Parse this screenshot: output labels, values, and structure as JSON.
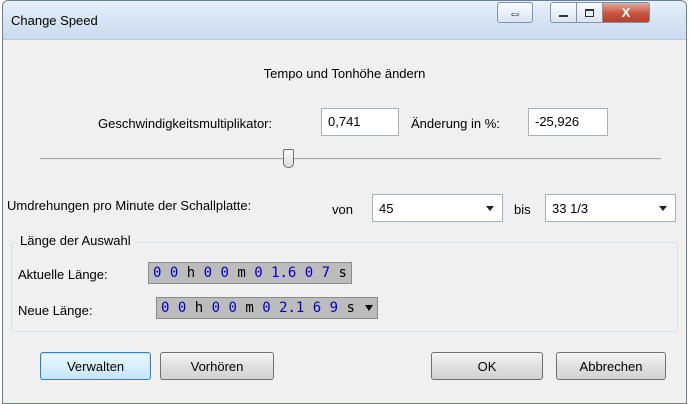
{
  "window": {
    "title": "Change Speed"
  },
  "titlebar": {
    "resize_glyph": "⇔",
    "close_glyph": "X"
  },
  "dialog": {
    "heading": "Tempo und Tonhöhe ändern",
    "multiplier_label": "Geschwindigkeitsmultiplikator:",
    "multiplier_value": "0,741",
    "percent_label": "Änderung in %:",
    "percent_value": "-25,926",
    "slider": {
      "position": 0.4
    },
    "rpm_label": "Umdrehungen pro Minute der Schallplatte:",
    "from_label": "von",
    "from_value": "45",
    "to_label": "bis",
    "to_value": "33 1/3"
  },
  "selection_length": {
    "legend": "Länge der Auswahl",
    "current_label": "Aktuelle Länge:",
    "current_time": {
      "h": "0 0",
      "m": "0 0",
      "s": "0 1.6 0 7"
    },
    "new_label": "Neue Länge:",
    "new_time": {
      "h": "0 0",
      "m": "0 0",
      "s": "0 2.1 6 9"
    },
    "units": {
      "h": "h",
      "m": "m",
      "s": "s"
    }
  },
  "buttons": {
    "manage": "Verwalten",
    "preview": "Vorhören",
    "ok": "OK",
    "cancel": "Abbrechen"
  },
  "colors": {
    "time_digits": "#0000c8",
    "close_button": "#c7533b"
  },
  "icons": {
    "resize": "resize-arrows-icon",
    "minimize": "minimize-icon",
    "maximize": "maximize-icon",
    "close": "close-icon",
    "dropdown": "chevron-down-icon"
  }
}
